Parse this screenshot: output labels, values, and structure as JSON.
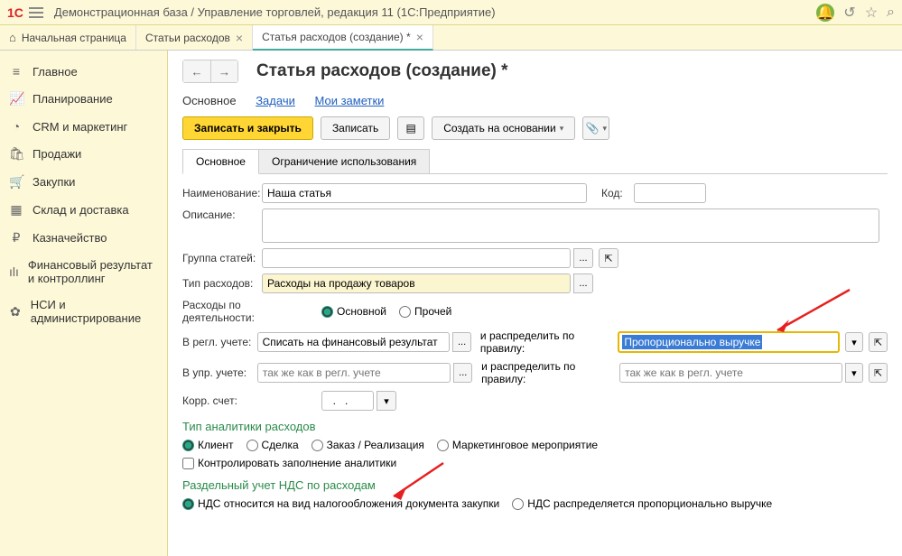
{
  "titlebar": {
    "logo": "1C",
    "title": "Демонстрационная база / Управление торговлей, редакция 11  (1С:Предприятие)"
  },
  "tabs": {
    "home": "Начальная страница",
    "t1": "Статьи расходов",
    "t2": "Статья расходов (создание) *"
  },
  "sidebar": {
    "items": [
      {
        "icon": "≡",
        "label": "Главное"
      },
      {
        "icon": "📈",
        "label": "Планирование"
      },
      {
        "icon": "◔",
        "label": "CRM и маркетинг"
      },
      {
        "icon": "🛍",
        "label": "Продажи"
      },
      {
        "icon": "🛒",
        "label": "Закупки"
      },
      {
        "icon": "▦",
        "label": "Склад и доставка"
      },
      {
        "icon": "₽",
        "label": "Казначейство"
      },
      {
        "icon": "ılı",
        "label": "Финансовый результат и контроллинг"
      },
      {
        "icon": "✿",
        "label": "НСИ и администрирование"
      }
    ]
  },
  "page": {
    "title": "Статья расходов (создание) *",
    "subnav": {
      "main": "Основное",
      "tasks": "Задачи",
      "notes": "Мои заметки"
    },
    "toolbar": {
      "save_close": "Записать и закрыть",
      "save": "Записать",
      "create": "Создать на основании"
    },
    "tabs": {
      "main": "Основное",
      "restrict": "Ограничение использования"
    },
    "form": {
      "name_label": "Наименование:",
      "name_value": "Наша статья",
      "code_label": "Код:",
      "code_value": "",
      "desc_label": "Описание:",
      "desc_value": "",
      "group_label": "Группа статей:",
      "group_value": "",
      "type_label": "Тип расходов:",
      "type_value": "Расходы на продажу товаров",
      "activity_label": "Расходы по деятельности:",
      "activity_main": "Основной",
      "activity_other": "Прочей",
      "regl_label": "В регл. учете:",
      "regl_value": "Списать на финансовый результат",
      "distribute_label": "и распределить по правилу:",
      "distribute_value": "Пропорционально выручке",
      "upr_label": "В упр. учете:",
      "upr_placeholder": "так же как в регл. учете",
      "distribute2_placeholder": "так же как в регл. учете",
      "korr_label": "Корр. счет:",
      "korr_value": "  .   .",
      "analytics_title": "Тип аналитики расходов",
      "a_client": "Клиент",
      "a_deal": "Сделка",
      "a_order": "Заказ / Реализация",
      "a_marketing": "Маркетинговое мероприятие",
      "control_label": "Контролировать заполнение аналитики",
      "vat_title": "Раздельный учет НДС по расходам",
      "vat_doc": "НДС относится на вид налогообложения документа закупки",
      "vat_prop": "НДС распределяется пропорционально выручке"
    }
  }
}
